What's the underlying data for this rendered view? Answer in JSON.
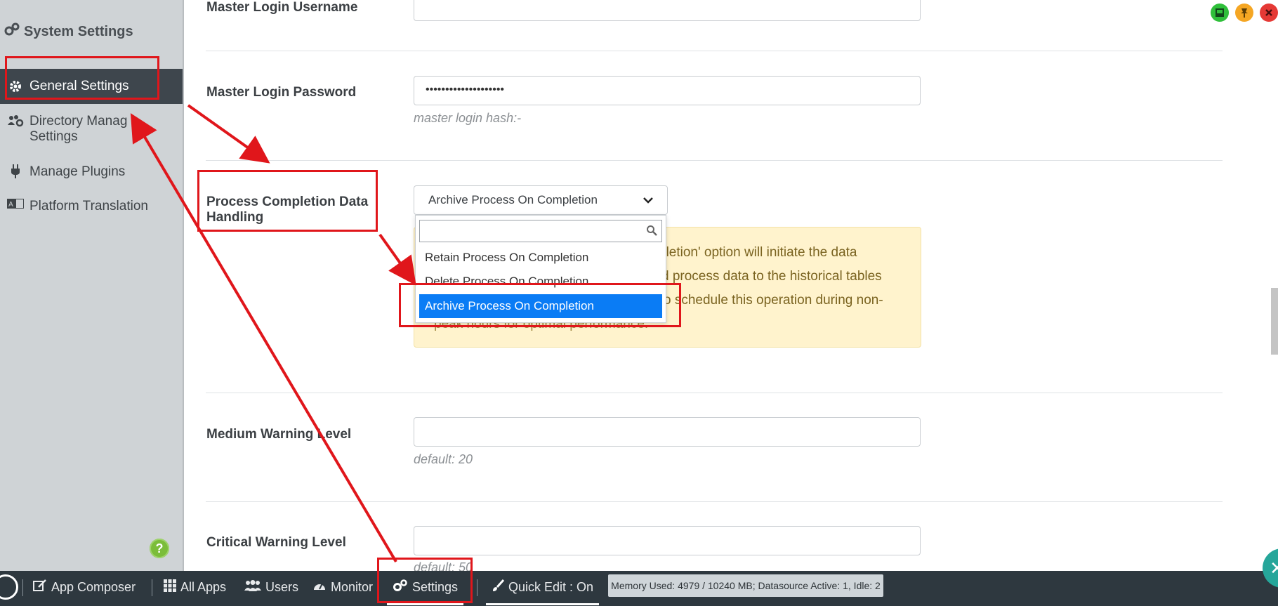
{
  "sidebar": {
    "title": "System Settings",
    "items": [
      {
        "label": "General Settings",
        "icon": "gear-icon",
        "active": true
      },
      {
        "label": "Directory Manag",
        "label2": "Settings",
        "icon": "users-gear-icon"
      },
      {
        "label": "Manage Plugins",
        "icon": "plug-icon"
      },
      {
        "label": "Platform Translation",
        "icon": "translate-icon"
      }
    ],
    "help": "?"
  },
  "form": {
    "master_username_label": "Master Login Username",
    "master_password_label": "Master Login Password",
    "master_password_value": "••••••••••••••••••••",
    "master_hash_hint": "master login hash:-",
    "process_label_line1": "Process Completion Data",
    "process_label_line2": "Handling",
    "process_select_value": "Archive Process On Completion",
    "info_line1": "pletion' option will initiate the data",
    "info_line2": "d process data to the historical tables",
    "info_line3": "o schedule this operation during non-",
    "info_line4": "peak hours for optimal performance.",
    "medium_label": "Medium Warning Level",
    "medium_hint": "default: 20",
    "critical_label": "Critical Warning Level",
    "critical_hint": "default: 50"
  },
  "dropdown": {
    "options": [
      "Retain Process On Completion",
      "Delete Process On Completion",
      "Archive Process On Completion"
    ],
    "selected_index": 2
  },
  "bottombar": {
    "app_composer": "App Composer",
    "all_apps": "All Apps",
    "users": "Users",
    "monitor": "Monitor",
    "settings": "Settings",
    "quick_edit": "Quick Edit : On",
    "memory": "Memory Used: 4979 / 10240 MB; Datasource Active: 1, Idle: 2"
  },
  "colors": {
    "accent": "#0a7cf5",
    "annotation": "#e0161b",
    "sidebar_bg": "#cfd3d6",
    "bottombar_bg": "#2e383f",
    "info_bg": "#fff3cd"
  }
}
